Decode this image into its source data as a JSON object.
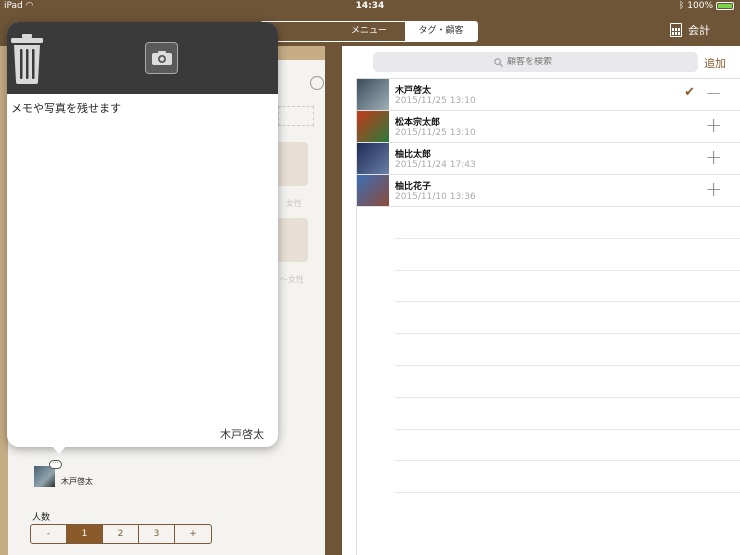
{
  "status": {
    "device": "iPad",
    "time": "14:34",
    "battery": "100%",
    "battery_level": 1.0
  },
  "nav": {
    "segments": [
      {
        "label": "",
        "active": false
      },
      {
        "label": "メニュー",
        "active": false
      },
      {
        "label": "タグ・顧客",
        "active": true
      }
    ],
    "checkout_label": "会計"
  },
  "left": {
    "faded_labels": [
      "女性",
      "〜女性"
    ],
    "current_customer": {
      "name": "木戸啓太",
      "bubble": "···"
    },
    "people": {
      "label": "人数",
      "options": [
        "-",
        "1",
        "2",
        "3",
        "+"
      ],
      "selected": "1"
    }
  },
  "popover": {
    "memo_placeholder": "メモや写真を残せます",
    "customer_name": "木戸啓太"
  },
  "right": {
    "search_placeholder": "顧客を検索",
    "add_label": "追加",
    "customers": [
      {
        "name": "木戸啓太",
        "date": "2015/11/25 13:10",
        "selected": true,
        "action": "−",
        "colors": [
          "#3a4d5c",
          "#9fb0b8"
        ]
      },
      {
        "name": "松本宗太郎",
        "date": "2015/11/25 13:10",
        "selected": false,
        "action": "+",
        "colors": [
          "#c23a1c",
          "#2a7a3a"
        ]
      },
      {
        "name": "柚比太郎",
        "date": "2015/11/24 17:43",
        "selected": false,
        "action": "+",
        "colors": [
          "#1c2b55",
          "#6a7fa8"
        ]
      },
      {
        "name": "柚比花子",
        "date": "2015/11/10 13:36",
        "selected": false,
        "action": "+",
        "colors": [
          "#3a6fb5",
          "#8c4a3a"
        ]
      }
    ],
    "empty_rows": 9
  },
  "colors": {
    "brand": "#8a5a2b",
    "header_bg": "#6e5538",
    "popover_header": "#3a3a3a"
  }
}
